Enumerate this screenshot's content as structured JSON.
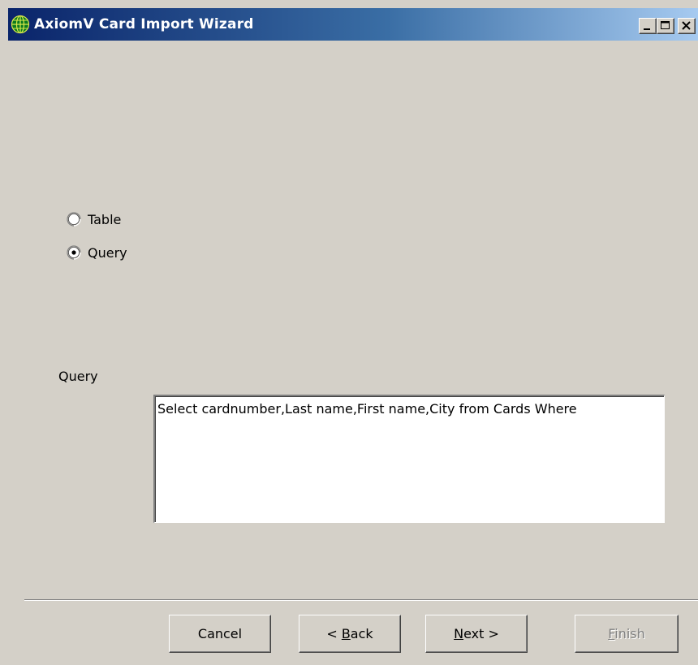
{
  "window": {
    "title": "AxiomV  Card Import Wizard",
    "icon": "globe-icon",
    "controls": {
      "minimize": "minimize-icon",
      "maximize": "maximize-icon",
      "close": "close-icon"
    }
  },
  "source_options": [
    {
      "label": "Table",
      "checked": false
    },
    {
      "label": "Query",
      "checked": true
    }
  ],
  "query": {
    "label": "Query",
    "value": "Select cardnumber,Last name,First name,City from Cards Where"
  },
  "buttons": {
    "cancel": "Cancel",
    "back_prefix": "< ",
    "back_accel": "B",
    "back_rest": "ack",
    "next_accel": "N",
    "next_rest": "ext >",
    "finish_accel": "F",
    "finish_rest": "inish",
    "finish_enabled": false
  },
  "colors": {
    "title_gradient_start": "#0a246a",
    "title_gradient_end": "#a6caf0",
    "face": "#d4d0c8",
    "disabled_text": "#808080"
  }
}
